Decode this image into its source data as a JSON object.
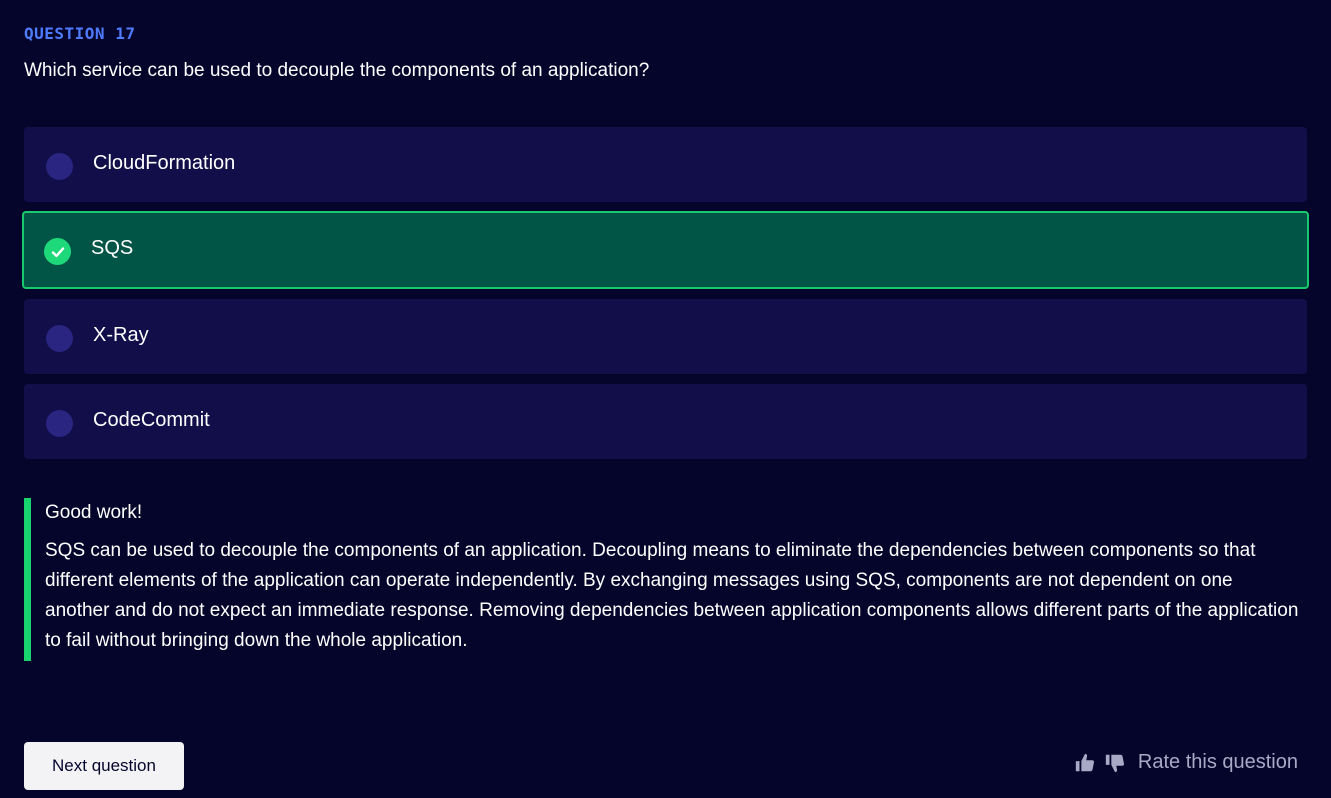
{
  "question": {
    "label": "QUESTION 17",
    "text": "Which service can be used to decouple the components of an application?"
  },
  "options": [
    {
      "label": "CloudFormation",
      "selected": false
    },
    {
      "label": "SQS",
      "selected": true
    },
    {
      "label": "X-Ray",
      "selected": false
    },
    {
      "label": "CodeCommit",
      "selected": false
    }
  ],
  "feedback": {
    "title": "Good work!",
    "body": "SQS can be used to decouple the components of an application. Decoupling means to eliminate the dependencies between components so that different elements of the application can operate independently. By exchanging messages using SQS, components are not dependent on one another and do not expect an immediate response. Removing dependencies between application components allows different parts of the application to fail without bringing down the whole application."
  },
  "footer": {
    "next_label": "Next question",
    "rate_label": "Rate this question"
  },
  "colors": {
    "background": "#05052c",
    "accent": "#4f7bff",
    "success": "#18d46e",
    "option_bg": "#110e4a",
    "selected_bg": "#015546"
  }
}
